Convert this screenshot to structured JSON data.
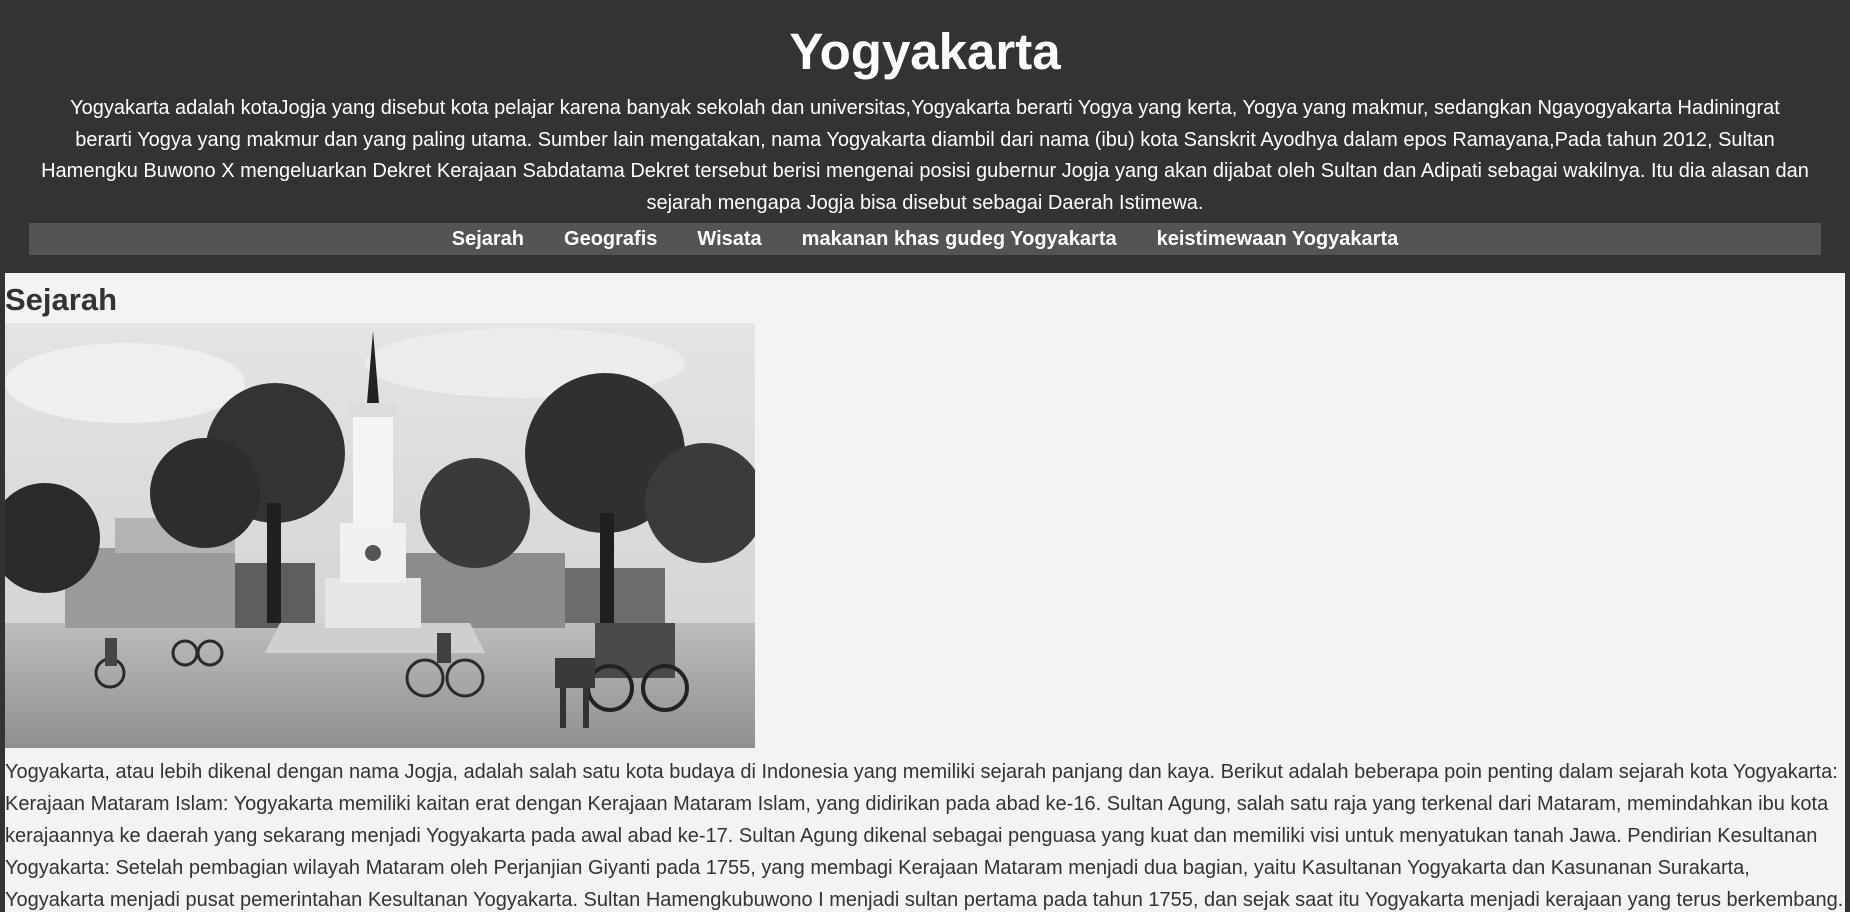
{
  "header": {
    "title": "Yogyakarta",
    "intro": "Yogyakarta adalah kotaJogja yang disebut kota pelajar karena banyak sekolah dan universitas,Yogyakarta berarti Yogya yang kerta, Yogya yang makmur, sedangkan Ngayogyakarta Hadiningrat berarti Yogya yang makmur dan yang paling utama. Sumber lain mengatakan, nama Yogyakarta diambil dari nama (ibu) kota Sanskrit Ayodhya dalam epos Ramayana,Pada tahun 2012, Sultan Hamengku Buwono X mengeluarkan Dekret Kerajaan Sabdatama Dekret tersebut berisi mengenai posisi gubernur Jogja yang akan dijabat oleh Sultan dan Adipati sebagai wakilnya. Itu dia alasan dan sejarah mengapa Jogja bisa disebut sebagai Daerah Istimewa."
  },
  "nav": {
    "items": [
      {
        "label": "Sejarah"
      },
      {
        "label": "Geografis"
      },
      {
        "label": "Wisata"
      },
      {
        "label": "makanan khas gudeg Yogyakarta"
      },
      {
        "label": "keistimewaan Yogyakarta"
      }
    ]
  },
  "section": {
    "title": "Sejarah",
    "image_icon": "tugu-yogyakarta-photo",
    "text": "Yogyakarta, atau lebih dikenal dengan nama Jogja, adalah salah satu kota budaya di Indonesia yang memiliki sejarah panjang dan kaya. Berikut adalah beberapa poin penting dalam sejarah kota Yogyakarta: Kerajaan Mataram Islam: Yogyakarta memiliki kaitan erat dengan Kerajaan Mataram Islam, yang didirikan pada abad ke-16. Sultan Agung, salah satu raja yang terkenal dari Mataram, memindahkan ibu kota kerajaannya ke daerah yang sekarang menjadi Yogyakarta pada awal abad ke-17. Sultan Agung dikenal sebagai penguasa yang kuat dan memiliki visi untuk menyatukan tanah Jawa. Pendirian Kesultanan Yogyakarta: Setelah pembagian wilayah Mataram oleh Perjanjian Giyanti pada 1755, yang membagi Kerajaan Mataram menjadi dua bagian, yaitu Kasultanan Yogyakarta dan Kasunanan Surakarta, Yogyakarta menjadi pusat pemerintahan Kesultanan Yogyakarta. Sultan Hamengkubuwono I menjadi sultan pertama pada tahun 1755, dan sejak saat itu Yogyakarta menjadi kerajaan yang terus berkembang."
  },
  "colors": {
    "header_bg": "#333333",
    "nav_bg": "#545454",
    "page_bg": "#f3f3f6",
    "text": "#333333"
  }
}
